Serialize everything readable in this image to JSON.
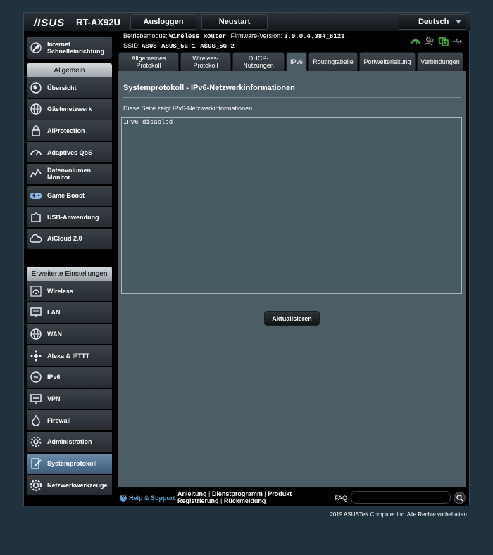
{
  "header": {
    "logo": "/ISUS",
    "model": "RT-AX92U",
    "logout_label": "Ausloggen",
    "reboot_label": "Neustart",
    "language": "Deutsch"
  },
  "info": {
    "mode_label": "Betriebsmodus:",
    "mode_value": "Wireless Router",
    "firmware_label": "Firmware-Version:",
    "firmware_value": "3.0.0.4.384_6121",
    "ssid_label": "SSID:",
    "ssids": [
      "ASUS",
      "ASUS_5G-1",
      "ASUS_5G-2"
    ]
  },
  "sidebar": {
    "quick_setup": "Internet Schnelleinrichtung",
    "general_head": "Allgemein",
    "general_items": [
      {
        "label": "Übersicht",
        "icon": "globe-map-icon"
      },
      {
        "label": "Gästenetzwerk",
        "icon": "globe-icon"
      },
      {
        "label": "AiProtection",
        "icon": "lock-icon"
      },
      {
        "label": "Adaptives QoS",
        "icon": "gauge-icon"
      },
      {
        "label": "Datenvolumen Monitor",
        "icon": "traffic-chart-icon"
      },
      {
        "label": "Game Boost",
        "icon": "gamepad-icon"
      },
      {
        "label": "USB-Anwendung",
        "icon": "puzzle-icon"
      },
      {
        "label": "AiCloud 2.0",
        "icon": "cloud-icon"
      }
    ],
    "advanced_head": "Erweiterte Einstellungen",
    "advanced_items": [
      {
        "label": "Wireless",
        "icon": "wifi-icon"
      },
      {
        "label": "LAN",
        "icon": "lan-icon"
      },
      {
        "label": "WAN",
        "icon": "globe-icon"
      },
      {
        "label": "Alexa & IFTTT",
        "icon": "alexa-icon"
      },
      {
        "label": "IPv6",
        "icon": "ipv6-icon"
      },
      {
        "label": "VPN",
        "icon": "vpn-icon"
      },
      {
        "label": "Firewall",
        "icon": "fire-icon"
      },
      {
        "label": "Administration",
        "icon": "admin-gear-icon"
      },
      {
        "label": "Systemprotokoll",
        "icon": "log-pencil-icon"
      },
      {
        "label": "Netzwerkwerkzeuge",
        "icon": "tools-gear-icon"
      }
    ],
    "active_item": "Systemprotokoll"
  },
  "tabs": [
    "Allgemeines Protokoll",
    "Wireless-Protokoll",
    "DHCP-Nutzungen",
    "IPv6",
    "Routingtabelle",
    "Portweiterleitung",
    "Verbindungen"
  ],
  "active_tab": "IPv6",
  "content": {
    "title": "Systemprotokoll - IPv6-Netzwerkinformationen",
    "description": "Diese Seite zeigt IPv6-Netzwerkinformationen.",
    "log_text": "IPv6 disabled",
    "refresh_label": "Aktualisieren"
  },
  "footer": {
    "help": "Help & Support",
    "links": [
      "Anleitung",
      "Dienstprogramm",
      "Produkt Registrierung",
      "Rückmeldung"
    ],
    "faq_label": "FAQ",
    "faq_placeholder": "",
    "copyright": "2019 ASUSTeK Computer Inc. Alle Rechte vorbehalten."
  },
  "colors": {
    "background": "#21323f",
    "content": "#4d5d66",
    "active_item": "#5a7c99",
    "help_link": "#5ba0d0"
  }
}
